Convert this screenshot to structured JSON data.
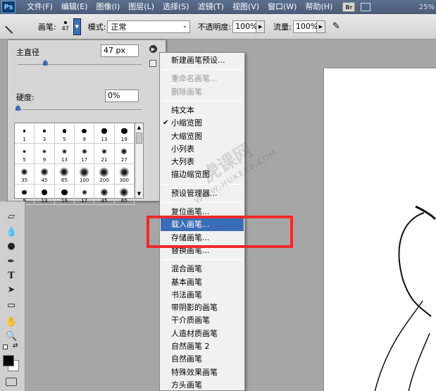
{
  "menubar": {
    "logo": "Ps",
    "items": [
      "文件(F)",
      "编辑(E)",
      "图像(I)",
      "图层(L)",
      "选择(S)",
      "滤镜(T)",
      "视图(V)",
      "窗口(W)",
      "帮助(H)"
    ],
    "bridge_badge": "Br",
    "zoom": "25%"
  },
  "options": {
    "brush_label": "画笔:",
    "brush_size": "47",
    "mode_label": "模式:",
    "mode_value": "正常",
    "opacity_label": "不透明度:",
    "opacity_value": "100%",
    "flow_label": "流量:",
    "flow_value": "100%"
  },
  "brush_panel": {
    "diameter_label": "主直径",
    "diameter_value": "47 px",
    "diameter_level": 0.22,
    "hardness_label": "硬度:",
    "hardness_value": "0%",
    "hardness_level": 0.0,
    "presets": [
      {
        "size": "1",
        "style": "hard"
      },
      {
        "size": "3",
        "style": "hard"
      },
      {
        "size": "5",
        "style": "hard"
      },
      {
        "size": "9",
        "style": "hard"
      },
      {
        "size": "13",
        "style": "hard"
      },
      {
        "size": "19",
        "style": "hard"
      },
      {
        "size": "5",
        "style": "soft"
      },
      {
        "size": "9",
        "style": "soft"
      },
      {
        "size": "13",
        "style": "soft"
      },
      {
        "size": "17",
        "style": "soft"
      },
      {
        "size": "21",
        "style": "soft"
      },
      {
        "size": "27",
        "style": "soft"
      },
      {
        "size": "35",
        "style": "soft"
      },
      {
        "size": "45",
        "style": "soft"
      },
      {
        "size": "65",
        "style": "soft"
      },
      {
        "size": "100",
        "style": "soft"
      },
      {
        "size": "200",
        "style": "soft"
      },
      {
        "size": "300",
        "style": "soft"
      },
      {
        "size": "9",
        "style": "hard"
      },
      {
        "size": "13",
        "style": "hard"
      },
      {
        "size": "19",
        "style": "hard"
      },
      {
        "size": "17",
        "style": "soft"
      },
      {
        "size": "45",
        "style": "soft"
      },
      {
        "size": "65",
        "style": "soft"
      }
    ]
  },
  "context_menu": {
    "items": [
      {
        "label": "新建画笔预设...",
        "state": "normal"
      },
      {
        "sep": true
      },
      {
        "label": "重命名画笔...",
        "state": "disabled"
      },
      {
        "label": "删除画笔",
        "state": "disabled"
      },
      {
        "sep": true
      },
      {
        "label": "纯文本",
        "state": "normal"
      },
      {
        "label": "小缩览图",
        "state": "checked"
      },
      {
        "label": "大缩览图",
        "state": "normal"
      },
      {
        "label": "小列表",
        "state": "normal"
      },
      {
        "label": "大列表",
        "state": "normal"
      },
      {
        "label": "描边缩览图",
        "state": "normal"
      },
      {
        "sep": true
      },
      {
        "label": "预设管理器...",
        "state": "normal"
      },
      {
        "sep": true
      },
      {
        "label": "复位画笔...",
        "state": "normal"
      },
      {
        "label": "载入画笔...",
        "state": "highlight"
      },
      {
        "label": "存储画笔...",
        "state": "normal"
      },
      {
        "label": "替换画笔...",
        "state": "normal"
      },
      {
        "sep": true
      },
      {
        "label": "混合画笔",
        "state": "normal"
      },
      {
        "label": "基本画笔",
        "state": "normal"
      },
      {
        "label": "书法画笔",
        "state": "normal"
      },
      {
        "label": "带阴影的画笔",
        "state": "normal"
      },
      {
        "label": "干介质画笔",
        "state": "normal"
      },
      {
        "label": "人造材质画笔",
        "state": "normal"
      },
      {
        "label": "自然画笔 2",
        "state": "normal"
      },
      {
        "label": "自然画笔",
        "state": "normal"
      },
      {
        "label": "特殊效果画笔",
        "state": "normal"
      },
      {
        "label": "方头画笔",
        "state": "normal"
      }
    ]
  },
  "toolbox": {
    "tools": [
      "eraser-icon",
      "blur-icon",
      "dodge-icon",
      "pen-icon",
      "type-icon",
      "path-select-icon",
      "shape-icon",
      "hand-icon",
      "zoom-icon"
    ],
    "type_glyph": "T",
    "foreground_color": "#000000",
    "background_color": "#ffffff"
  },
  "colors": {
    "highlight": "#3a6db5",
    "annotation": "#ee2a2a"
  },
  "watermark": {
    "text": "虎课网",
    "sub": "WWW.HUKE88.COM"
  }
}
